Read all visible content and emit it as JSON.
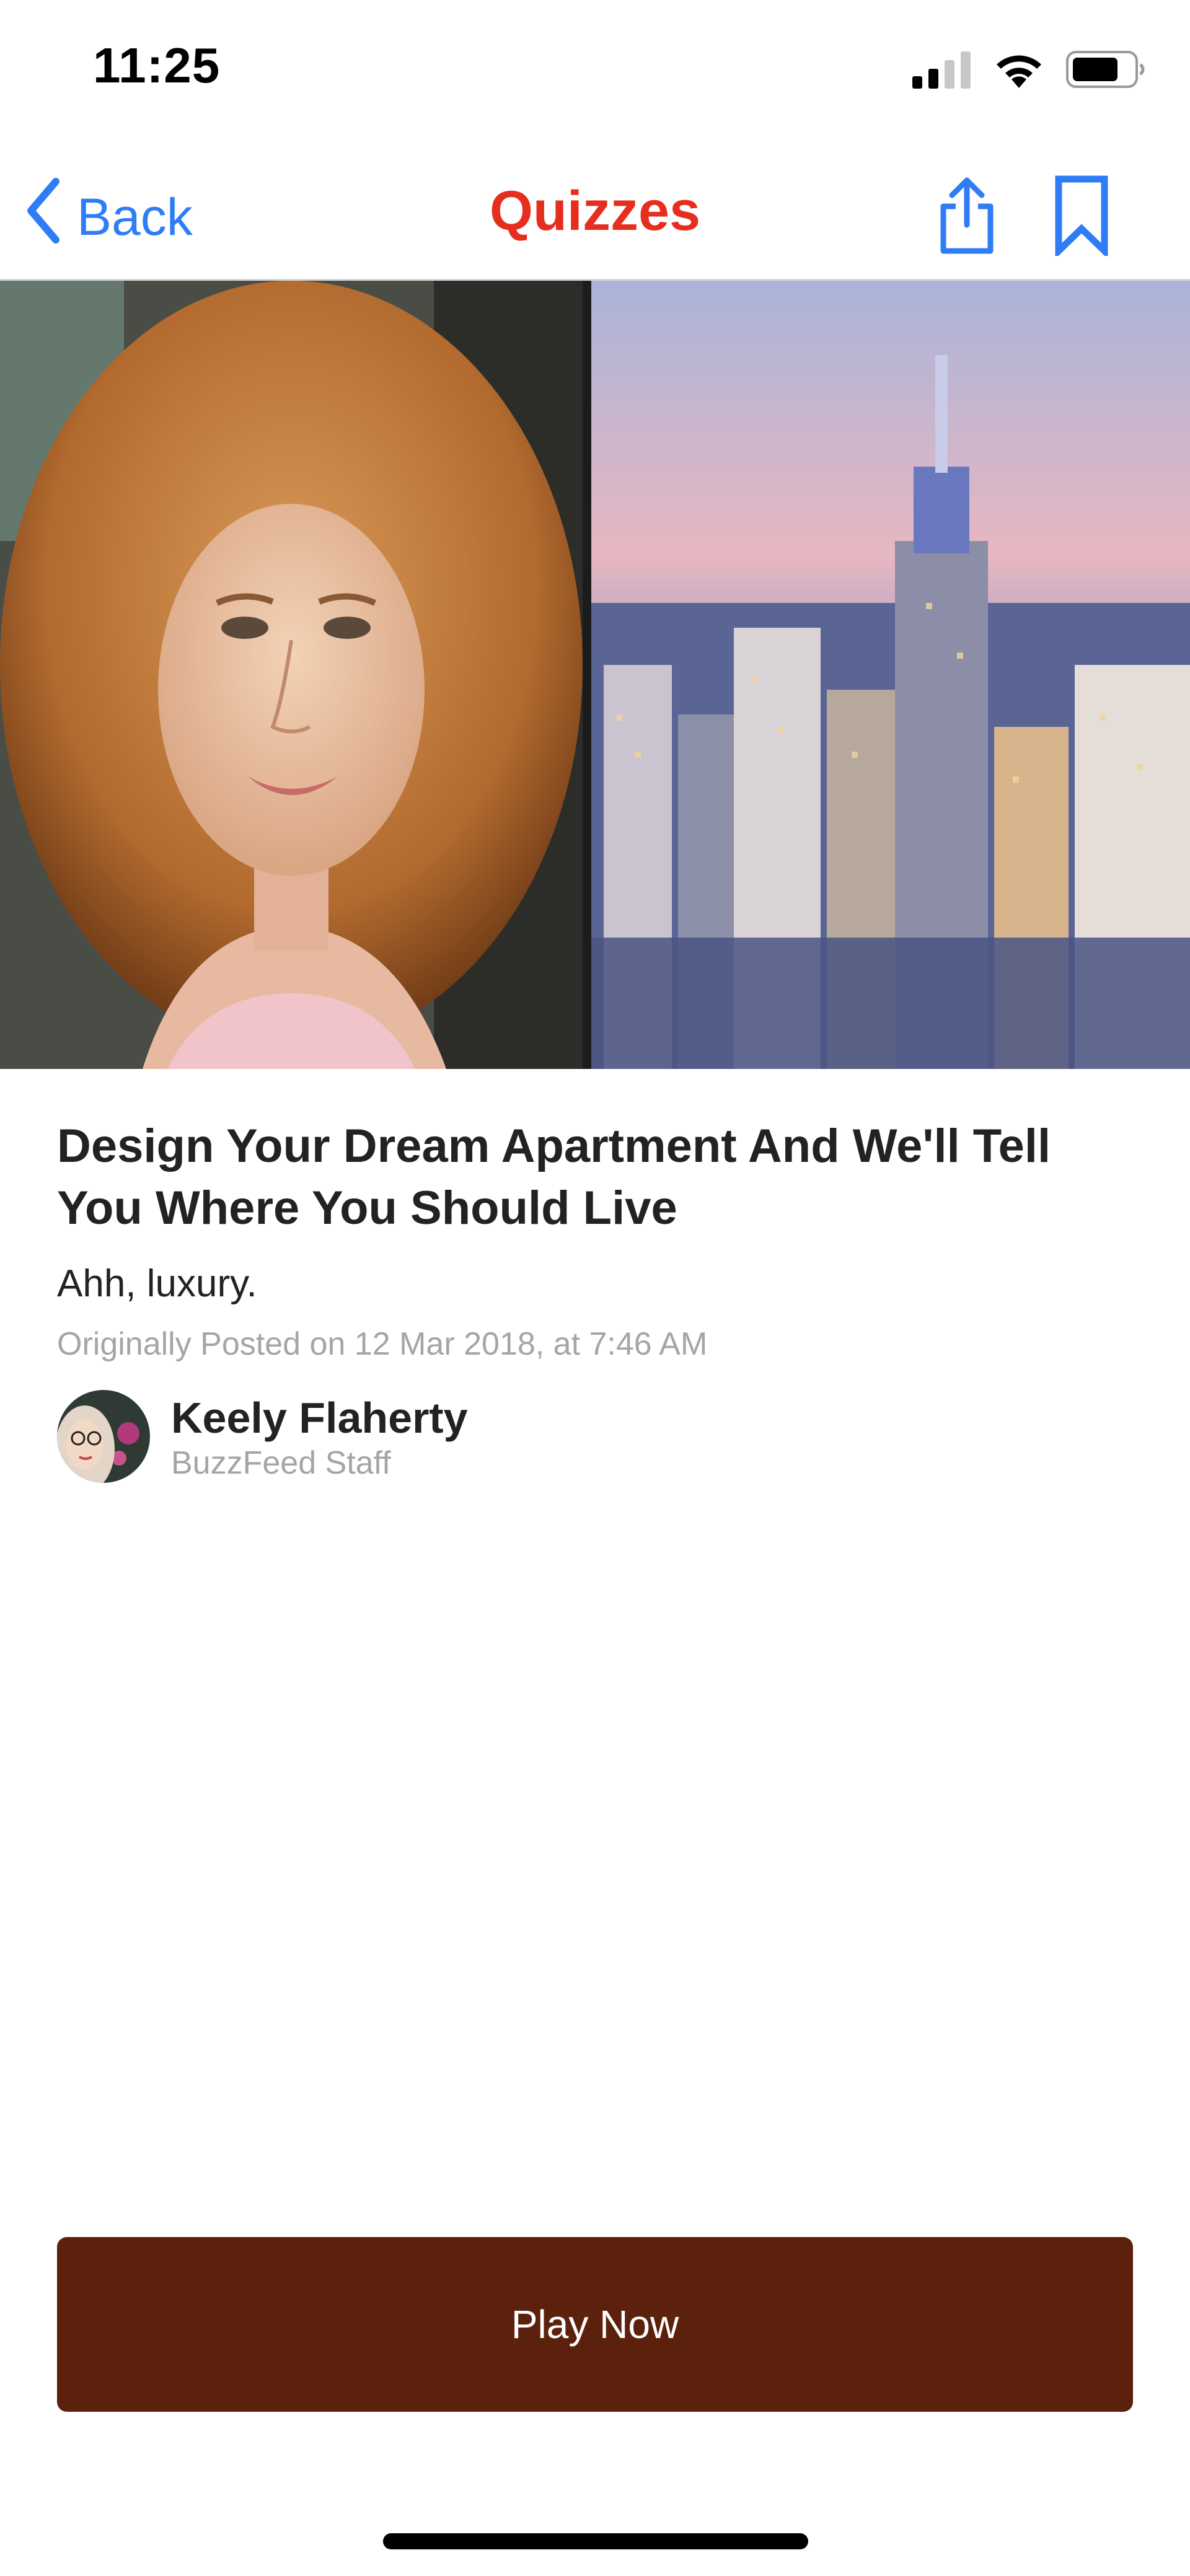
{
  "status_bar": {
    "time": "11:25",
    "icons": [
      "signal-icon",
      "wifi-icon",
      "battery-icon"
    ],
    "battery_level": 0.75
  },
  "nav": {
    "back_label": "Back",
    "title": "Quizzes",
    "back_icon": "chevron-left-icon",
    "share_icon": "share-icon",
    "bookmark_icon": "bookmark-icon"
  },
  "colors": {
    "accent_blue": "#2f7df6",
    "title_red": "#e62e1f",
    "button_brown": "#5c210c",
    "meta_gray": "#a5a5a5"
  },
  "article": {
    "title": "Design Your Dream Apartment And We'll Tell You Where You Should Live",
    "subtitle": "Ahh, luxury.",
    "posted": "Originally Posted on 12 Mar 2018, at 7:46 AM"
  },
  "author": {
    "name": "Keely Flaherty",
    "role": "BuzzFeed Staff"
  },
  "cta": {
    "label": "Play Now"
  }
}
